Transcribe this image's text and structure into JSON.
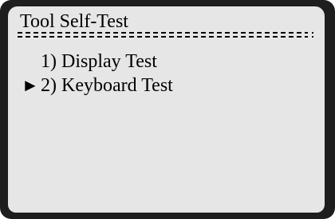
{
  "screen": {
    "title": "Tool Self-Test",
    "separator": "==============================:",
    "menu": {
      "items": [
        {
          "label": "1) Display Test",
          "selected": false
        },
        {
          "label": "2) Keyboard Test",
          "selected": true
        }
      ],
      "cursor_glyph": "►"
    }
  },
  "colors": {
    "bezel": "#1e1e1e",
    "screen_background": "#e6e6e6",
    "text": "#000000"
  }
}
